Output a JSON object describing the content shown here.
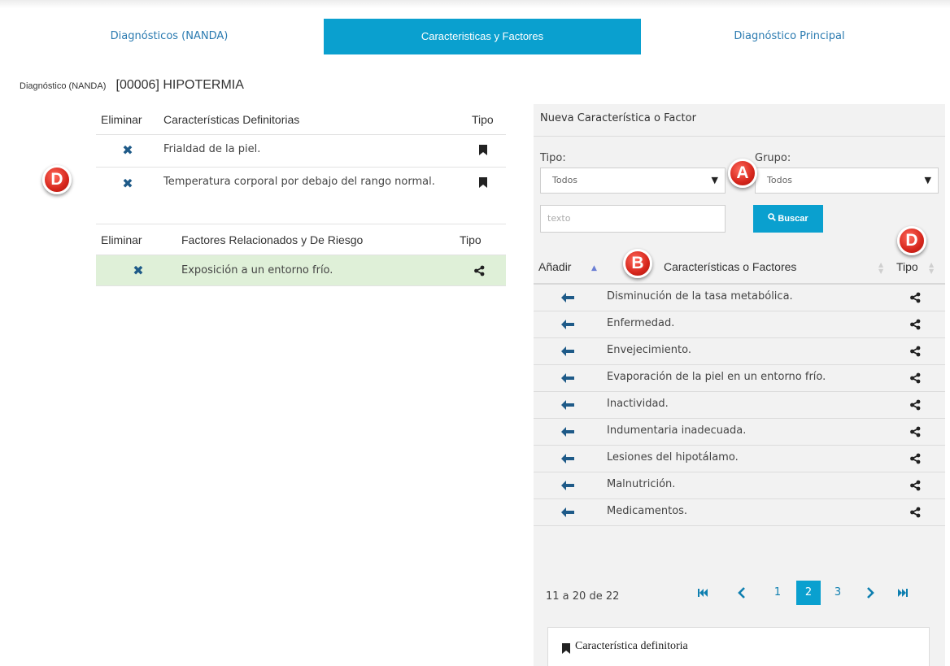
{
  "tabs": [
    {
      "label": "Diagnósticos (NANDA)",
      "active": false
    },
    {
      "label": "Caracteristicas y Factores",
      "active": true
    },
    {
      "label": "Diagnóstico Principal",
      "active": false
    }
  ],
  "diagnosis": {
    "label": "Diagnóstico (NANDA)",
    "value": "[00006] HIPOTERMIA"
  },
  "defining": {
    "headers": {
      "remove": "Eliminar",
      "name": "Características Definitorias",
      "type": "Tipo"
    },
    "rows": [
      {
        "text": "Frialdad de la piel.",
        "type_icon": "bookmark-icon"
      },
      {
        "text": "Temperatura corporal por debajo del rango normal.",
        "type_icon": "bookmark-icon"
      }
    ]
  },
  "factors": {
    "headers": {
      "remove": "Eliminar",
      "name": "Factores Relacionados y De Riesgo",
      "type": "Tipo"
    },
    "rows": [
      {
        "text": "Exposición a un entorno frío.",
        "type_icon": "share-icon"
      }
    ]
  },
  "new_panel": {
    "title": "Nueva Característica o Factor",
    "tipo_label": "Tipo:",
    "tipo_value": "Todos",
    "grupo_label": "Grupo:",
    "grupo_value": "Todos",
    "search_placeholder": "texto",
    "search_button": "Buscar",
    "table_headers": {
      "add": "Añadir",
      "name": "Características o Factores",
      "type": "Tipo"
    },
    "rows": [
      {
        "text": "Disminución de la tasa metabólica."
      },
      {
        "text": "Enfermedad."
      },
      {
        "text": "Envejecimiento."
      },
      {
        "text": "Evaporación de la piel en un entorno frío."
      },
      {
        "text": "Inactividad."
      },
      {
        "text": "Indumentaria inadecuada."
      },
      {
        "text": "Lesiones del hipotálamo."
      },
      {
        "text": "Malnutrición."
      },
      {
        "text": "Medicamentos."
      }
    ],
    "pagination": {
      "info": "11 a 20 de 22",
      "pages": [
        "1",
        "2",
        "3"
      ],
      "current": "2"
    },
    "legend": "Característica definitoria"
  },
  "badges": {
    "a": "A",
    "b": "B",
    "d1": "D",
    "d2": "D"
  },
  "colors": {
    "accent": "#0aa0cf",
    "link": "#2a7ab0",
    "remove": "#1e5a88",
    "highlight_row": "#dff0d8",
    "badge": "#d6261c"
  }
}
